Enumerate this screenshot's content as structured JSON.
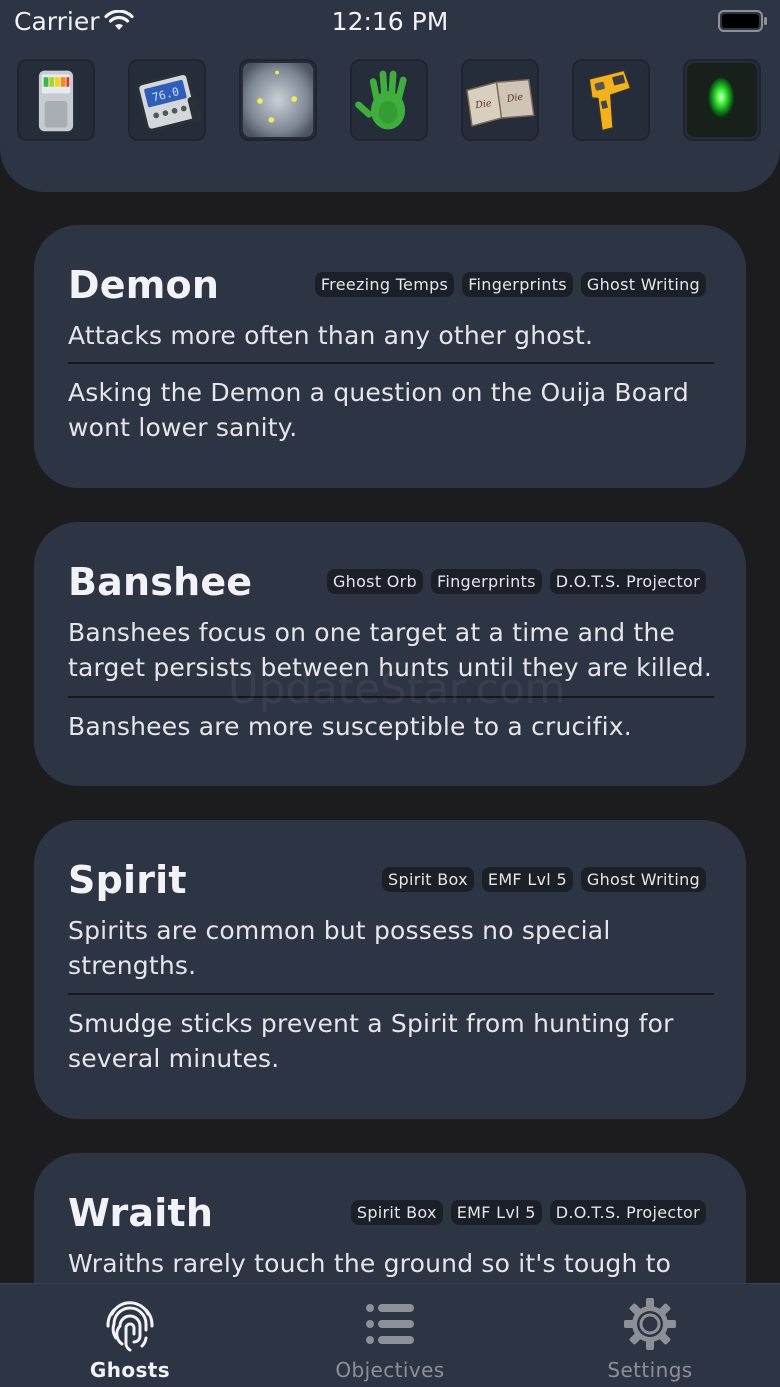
{
  "status_bar": {
    "carrier": "Carrier",
    "time": "12:16 PM"
  },
  "tools": [
    {
      "icon": "emf-reader-icon"
    },
    {
      "icon": "spirit-box-icon"
    },
    {
      "icon": "dots-projector-icon"
    },
    {
      "icon": "fingerprint-hand-icon"
    },
    {
      "icon": "ghost-writing-book-icon"
    },
    {
      "icon": "thermometer-icon"
    },
    {
      "icon": "ghost-orb-icon"
    }
  ],
  "ghosts": [
    {
      "name": "Demon",
      "evidence": [
        "Freezing Temps",
        "Fingerprints",
        "Ghost Writing"
      ],
      "strength": "Attacks more often than any other ghost.",
      "weakness": "Asking the Demon a question on the Ouija Board wont lower sanity."
    },
    {
      "name": "Banshee",
      "evidence": [
        "Ghost Orb",
        "Fingerprints",
        "D.O.T.S. Projector"
      ],
      "strength": "Banshees focus on one target at a time and the target persists between hunts until they are killed.",
      "weakness": "Banshees are more susceptible to a crucifix."
    },
    {
      "name": "Spirit",
      "evidence": [
        "Spirit Box",
        "EMF Lvl 5",
        "Ghost Writing"
      ],
      "strength": "Spirits are common but possess no special strengths.",
      "weakness": "Smudge sticks prevent a Spirit from hunting for several minutes."
    },
    {
      "name": "Wraith",
      "evidence": [
        "Spirit Box",
        "EMF Lvl 5",
        "D.O.T.S. Projector"
      ],
      "strength": "Wraiths rarely touch the ground so it's tough to"
    }
  ],
  "watermark": "UpdateStar.com",
  "tabbar": {
    "tabs": [
      {
        "label": "Ghosts",
        "icon": "fingerprint-icon",
        "active": true
      },
      {
        "label": "Objectives",
        "icon": "list-icon",
        "active": false
      },
      {
        "label": "Settings",
        "icon": "gear-icon",
        "active": false
      }
    ]
  },
  "colors": {
    "background": "#1c1c1e",
    "card": "#2d3444",
    "tag": "#1b1f27",
    "active_tab": "#f2f2f7",
    "inactive_tab": "#8e9097"
  }
}
